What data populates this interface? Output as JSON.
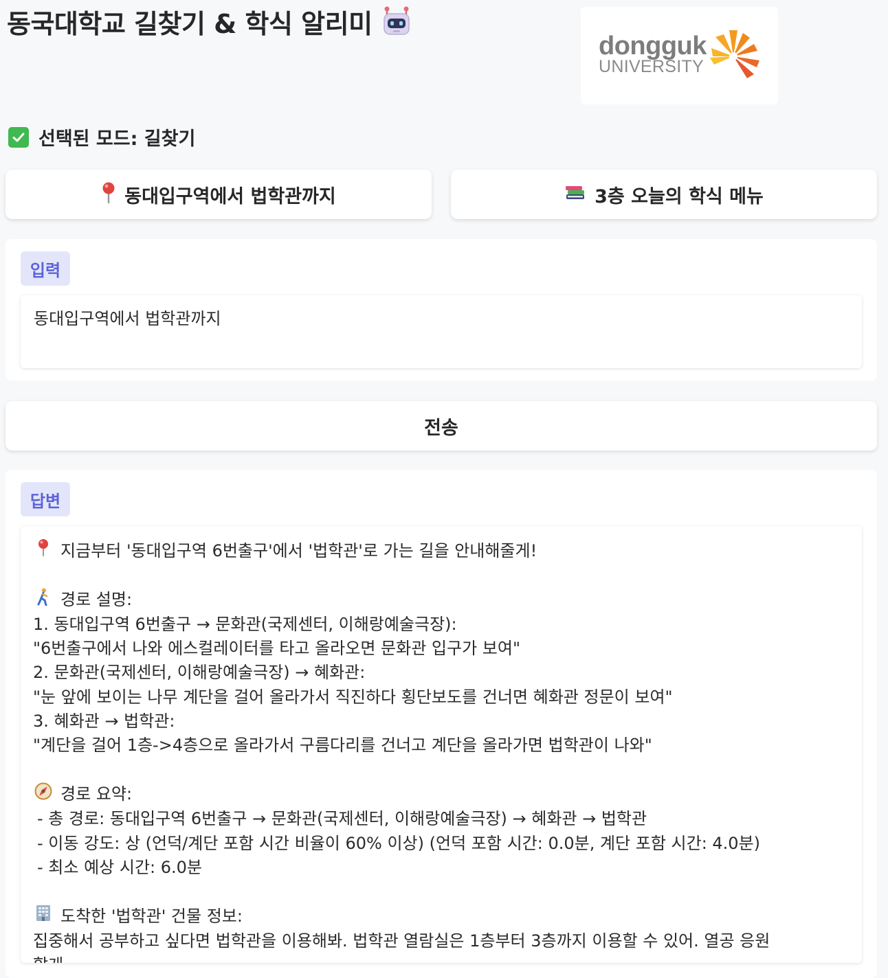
{
  "header": {
    "title": "동국대학교 길찾기 & 학식 알리미",
    "title_icon": "robot-icon"
  },
  "logo": {
    "word": "dongguk",
    "sub": "UNIVERSITY"
  },
  "mode": {
    "text": "선택된 모드: 길찾기",
    "icon": "check-icon"
  },
  "quick_buttons": [
    {
      "label": "동대입구역에서 법학관까지",
      "icon": "pin-icon"
    },
    {
      "label": "3층 오늘의 학식 메뉴",
      "icon": "books-icon"
    }
  ],
  "input": {
    "label": "입력",
    "value": "동대입구역에서 법학관까지"
  },
  "send_label": "전송",
  "answer": {
    "label": "답변",
    "lines": [
      "지금부터 '동대입구역 6번출구'에서 '법학관'로 가는 길을 안내해줄게!",
      "",
      "경로 설명:",
      "1. 동대입구역 6번출구 → 문화관(국제센터, 이해랑예술극장):",
      "\"6번출구에서 나와 에스컬레이터를 타고 올라오면 문화관 입구가 보여\"",
      "2. 문화관(국제센터, 이해랑예술극장) → 혜화관:",
      "\"눈 앞에 보이는 나무 계단을 걸어 올라가서 직진하다 횡단보도를 건너면 혜화관 정문이 보여\"",
      "3. 혜화관 → 법학관:",
      "\"계단을 걸어 1층->4층으로 올라가서 구름다리를 건너고 계단을 올라가면 법학관이 나와\"",
      "",
      "경로 요약:",
      "- 총 경로: 동대입구역 6번출구 → 문화관(국제센터, 이해랑예술극장) → 혜화관 → 법학관",
      "- 이동 강도: 상 (언덕/계단 포함 시간 비율이 60% 이상) (언덕 포함 시간: 0.0분, 계단 포함 시간: 4.0분)",
      "- 최소 예상 시간: 6.0분",
      "",
      "도착한 '법학관' 건물 정보:",
      "집중해서 공부하고 싶다면 법학관을 이용해봐. 법학관 열람실은 1층부터 3층까지 이용할 수 있어. 열공 응원",
      "할게"
    ]
  },
  "colors": {
    "page_bg": "#f7f8fa",
    "label_bg": "#e3e6fb",
    "label_text": "#5b63d6",
    "check_green": "#3fb950",
    "logo_orange": "#f7941d"
  }
}
